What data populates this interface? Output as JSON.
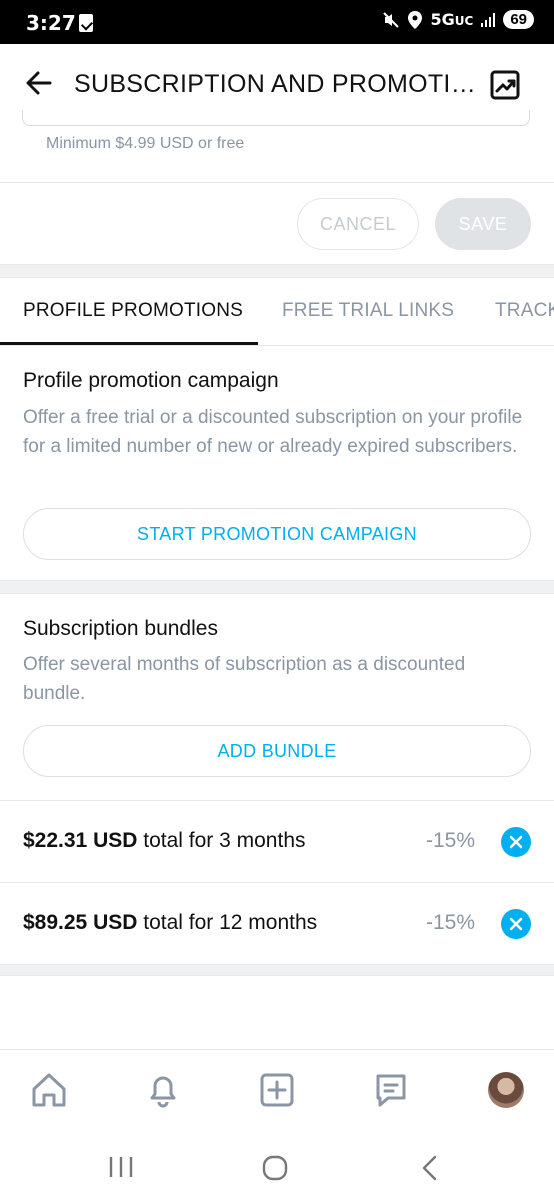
{
  "status_bar": {
    "time": "3:27",
    "network": "5G",
    "network_sub": "UC",
    "battery": "69"
  },
  "header": {
    "title": "SUBSCRIPTION AND PROMOTIONS"
  },
  "price_hint": "Minimum $4.99 USD or free",
  "actions": {
    "cancel": "CANCEL",
    "save": "SAVE"
  },
  "tabs": [
    {
      "label": "PROFILE PROMOTIONS",
      "active": true
    },
    {
      "label": "FREE TRIAL LINKS",
      "active": false
    },
    {
      "label": "TRACKING LINKS",
      "active": false
    }
  ],
  "promotion_campaign": {
    "title": "Profile promotion campaign",
    "description": "Offer a free trial or a discounted subscription on your profile for a limited number of new or already expired subscribers.",
    "button": "START PROMOTION CAMPAIGN"
  },
  "bundles": {
    "title": "Subscription bundles",
    "description": "Offer several months of subscription as a discounted bundle.",
    "button": "ADD BUNDLE",
    "items": [
      {
        "price": "$22.31 USD",
        "label": "total for 3 months",
        "discount": "-15%"
      },
      {
        "price": "$89.25 USD",
        "label": "total for 12 months",
        "discount": "-15%"
      }
    ]
  },
  "bottom_nav": [
    "home-icon",
    "bell-icon",
    "plus-square-icon",
    "chat-icon",
    "avatar"
  ],
  "colors": {
    "accent": "#00aff0",
    "muted_text": "#8a96a3",
    "divider": "#e6e8ea"
  }
}
